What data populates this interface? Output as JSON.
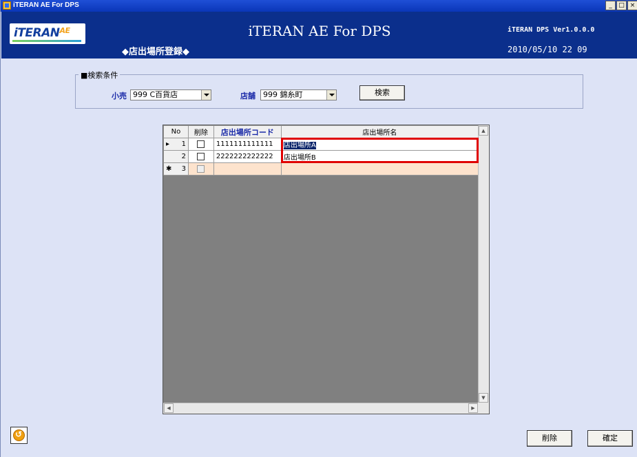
{
  "window": {
    "title": "iTERAN AE For DPS"
  },
  "header": {
    "logo_text": "iTERAN",
    "logo_suffix": "AE",
    "app_title": "iTERAN AE For DPS",
    "screen_title": "◆店出場所登録◆",
    "version": "iTERAN DPS Ver1.0.0.0",
    "datetime": "2010/05/10 22 09"
  },
  "search": {
    "legend": "■検索条件",
    "retail_label": "小売",
    "retail_value": "999 C百貨店",
    "store_label": "店舗",
    "store_value": "999 錦糸町",
    "search_button": "検索"
  },
  "grid": {
    "columns": [
      "No",
      "削除",
      "店出場所コード",
      "店出場所名"
    ],
    "rows": [
      {
        "no": "1",
        "code": "1111111111111",
        "name": "店出場所A",
        "current": true
      },
      {
        "no": "2",
        "code": "2222222222222",
        "name": "店出場所B",
        "current": false
      }
    ],
    "new_row_no": "3"
  },
  "footer": {
    "delete_button": "削除",
    "confirm_button": "確定"
  },
  "colors": {
    "header_bg": "#0b2f8c",
    "window_bg": "#dde3f6",
    "highlight": "#e00000",
    "new_row": "#fde3cd"
  }
}
